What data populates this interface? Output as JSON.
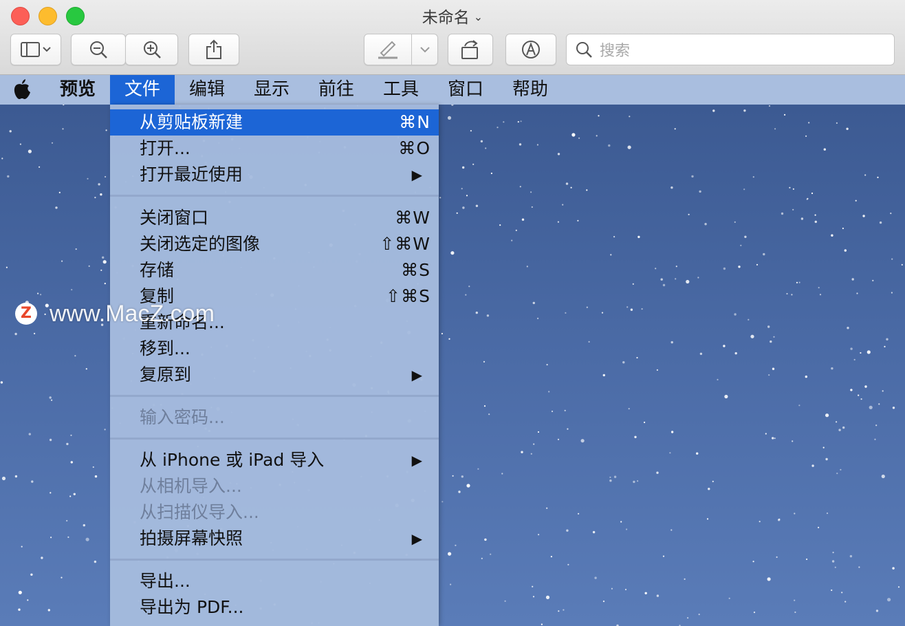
{
  "window": {
    "title": "未命名",
    "title_chevron": "⌄"
  },
  "toolbar": {
    "search_placeholder": "搜索"
  },
  "menubar": {
    "apple": "",
    "items": [
      {
        "label": "预览"
      },
      {
        "label": "文件"
      },
      {
        "label": "编辑"
      },
      {
        "label": "显示"
      },
      {
        "label": "前往"
      },
      {
        "label": "工具"
      },
      {
        "label": "窗口"
      },
      {
        "label": "帮助"
      }
    ]
  },
  "file_menu": {
    "items": [
      {
        "label": "从剪贴板新建",
        "shortcut": "⌘N",
        "state": "highlighted"
      },
      {
        "label": "打开...",
        "shortcut": "⌘O"
      },
      {
        "label": "打开最近使用",
        "submenu": "▶"
      },
      {
        "label": "关闭窗口",
        "shortcut": "⌘W"
      },
      {
        "label": "关闭选定的图像",
        "shortcut": "⇧⌘W"
      },
      {
        "label": "存储",
        "shortcut": "⌘S"
      },
      {
        "label": "复制",
        "shortcut": "⇧⌘S"
      },
      {
        "label": "重新命名..."
      },
      {
        "label": "移到..."
      },
      {
        "label": "复原到",
        "submenu": "▶"
      },
      {
        "label": "输入密码...",
        "state": "disabled"
      },
      {
        "label": "从 iPhone 或 iPad 导入",
        "submenu": "▶"
      },
      {
        "label": "从相机导入...",
        "state": "disabled"
      },
      {
        "label": "从扫描仪导入...",
        "state": "disabled"
      },
      {
        "label": "拍摄屏幕快照",
        "submenu": "▶"
      },
      {
        "label": "导出..."
      },
      {
        "label": "导出为 PDF..."
      }
    ]
  },
  "watermark": {
    "logo": "Z",
    "text": "www.MacZ.com"
  },
  "colors": {
    "menu_highlight": "#1c65d6",
    "menubar_bg": "#a9bedf",
    "desktop": "#4a6aa5"
  }
}
